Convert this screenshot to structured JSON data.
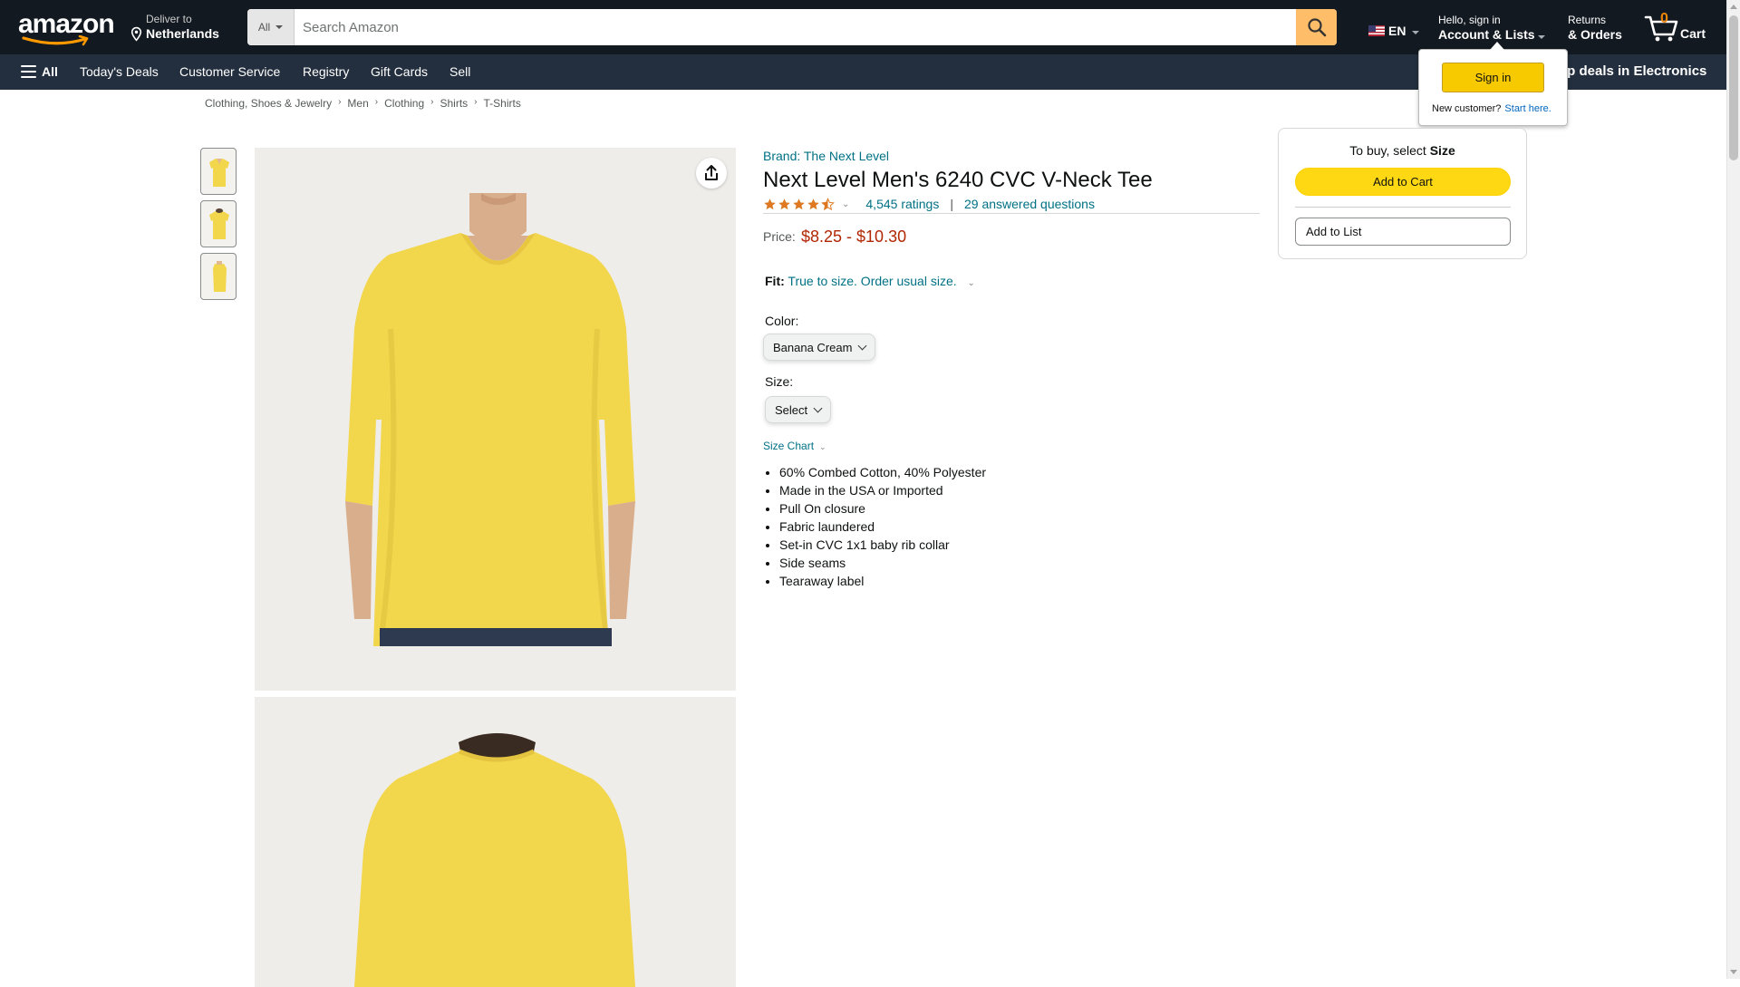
{
  "header": {
    "logo_text": "amazon",
    "deliver_line1": "Deliver to",
    "deliver_line2": "Netherlands",
    "search_category": "All",
    "search_placeholder": "Search Amazon",
    "language": "EN",
    "account_line1": "Hello, sign in",
    "account_line2": "Account & Lists",
    "returns_line1": "Returns",
    "returns_line2": "& Orders",
    "cart_count": "0",
    "cart_label": "Cart"
  },
  "subnav": {
    "all_label": "All",
    "links": [
      "Today's Deals",
      "Customer Service",
      "Registry",
      "Gift Cards",
      "Sell"
    ],
    "promo": "op deals in Electronics"
  },
  "flyout": {
    "signin_label": "Sign in",
    "new_customer": "New customer?",
    "start_here": "Start here."
  },
  "breadcrumb": [
    "Clothing, Shoes & Jewelry",
    "Men",
    "Clothing",
    "Shirts",
    "T-Shirts"
  ],
  "product": {
    "brand": "Brand: The Next Level",
    "title": "Next Level Men's 6240 CVC V-Neck Tee",
    "rating_value": 4.5,
    "ratings_count": "4,545 ratings",
    "answered": "29 answered questions",
    "price_label": "Price:",
    "price": "$8.25 - $10.30",
    "fit_label": "Fit:",
    "fit_value": "True to size. Order usual size.",
    "color_label": "Color:",
    "color_value": "Banana Cream",
    "size_label": "Size:",
    "size_value": "Select",
    "size_chart": "Size Chart",
    "bullets": [
      "60% Combed Cotton, 40% Polyester",
      "Made in the USA or Imported",
      "Pull On closure",
      "Fabric laundered",
      "Set-in CVC 1x1 baby rib collar",
      "Side seams",
      "Tearaway label"
    ]
  },
  "buybox": {
    "to_buy": "To buy, select",
    "to_buy_bold": "Size",
    "add_to_cart": "Add to Cart",
    "add_to_list": "Add to List"
  },
  "colors": {
    "nav_top": "#131921",
    "nav_sub": "#232f3e",
    "accent_orange": "#febd69",
    "link": "#007185",
    "price": "#b12704",
    "shirt": "#f2d64b"
  }
}
